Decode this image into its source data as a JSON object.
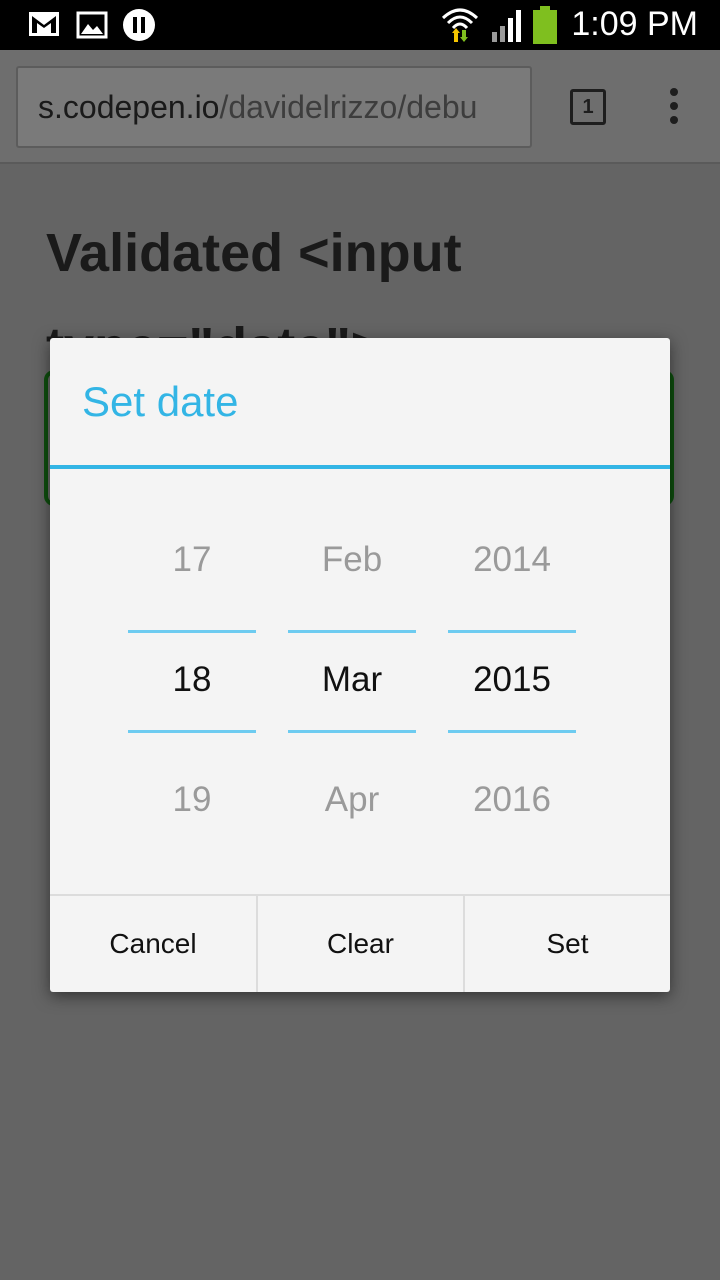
{
  "status_bar": {
    "time": "1:09 PM",
    "icons": [
      "gmail-icon",
      "gallery-icon",
      "pause-icon",
      "wifi-icon",
      "signal-icon",
      "battery-icon"
    ]
  },
  "browser": {
    "url_host": "s.codepen.io",
    "url_path": "/davidelrizzo/debu",
    "tab_count": "1"
  },
  "page": {
    "heading": "Validated <input type=\"date\">"
  },
  "date_dialog": {
    "title": "Set date",
    "day": {
      "prev": "17",
      "current": "18",
      "next": "19"
    },
    "month": {
      "prev": "Feb",
      "current": "Mar",
      "next": "Apr"
    },
    "year": {
      "prev": "2014",
      "current": "2015",
      "next": "2016"
    },
    "buttons": {
      "cancel": "Cancel",
      "clear": "Clear",
      "set": "Set"
    }
  },
  "colors": {
    "accent": "#33b5e5",
    "picker_line": "#6dcbf0",
    "input_border": "#0e4f0e",
    "scrim": "#646464"
  }
}
